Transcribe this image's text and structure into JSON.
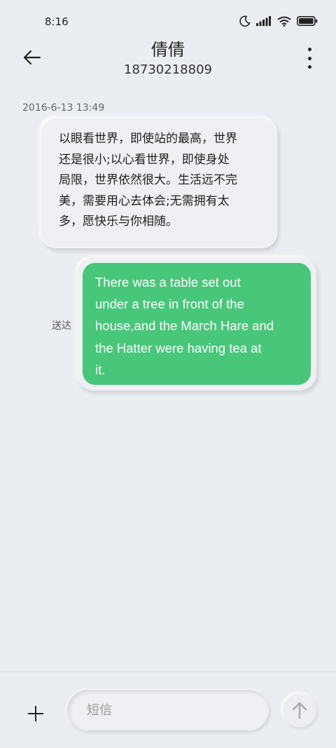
{
  "status_bar": {
    "time": "8:16"
  },
  "header": {
    "contact_name": "倩倩",
    "contact_number": "18730218809"
  },
  "conversation": {
    "timestamp": "2016-6-13 13:49",
    "incoming": {
      "lines": [
        "以眼看世界，即使站的最高，世界",
        "还是很小;以心看世界，即使身处",
        "局限，世界依然很大。生活远不完",
        "美，需要用心去体会;无需拥有太",
        "多，愿快乐与你相随。"
      ]
    },
    "outgoing": {
      "status": "送达",
      "lines": [
        "There was a table set out",
        "under a tree in front of the",
        "house,and the March Hare and",
        "the Hatter were having tea at",
        "it."
      ],
      "color": "#48c67a"
    }
  },
  "composer": {
    "placeholder": "短信"
  }
}
